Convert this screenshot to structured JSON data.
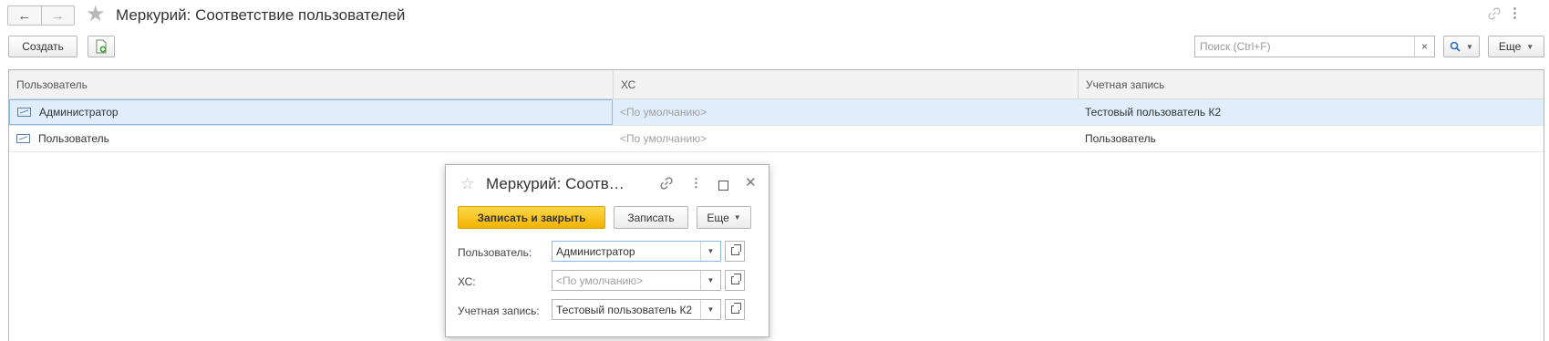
{
  "window": {
    "title": "Меркурий: Соответствие пользователей",
    "back_icon": "←",
    "forward_icon": "→",
    "favorite_icon": "★",
    "more_icon": "⋮"
  },
  "toolbar": {
    "create_label": "Создать",
    "search_placeholder": "Поиск (Ctrl+F)",
    "search_clear_icon": "×",
    "more_label": "Еще"
  },
  "table": {
    "columns": [
      "Пользователь",
      "ХС",
      "Учетная запись"
    ],
    "rows": [
      {
        "user": "Администратор",
        "hs": "<По умолчанию>",
        "account": "Тестовый пользователь К2",
        "selected": true
      },
      {
        "user": "Пользователь",
        "hs": "<По умолчанию>",
        "account": "Пользователь",
        "selected": false
      }
    ]
  },
  "dialog": {
    "title": "Меркурий: Соотв…",
    "star_icon": "☆",
    "more_icon": "⋮",
    "close_icon": "✕",
    "save_close_label": "Записать и закрыть",
    "save_label": "Записать",
    "more_label": "Еще",
    "fields": [
      {
        "label": "Пользователь:",
        "value": "Администратор",
        "placeholder": false
      },
      {
        "label": "ХС:",
        "value": "<По умолчанию>",
        "placeholder": true
      },
      {
        "label": "Учетная запись:",
        "value": "Тестовый пользователь К2",
        "placeholder": false
      }
    ]
  },
  "colors": {
    "accent_yellow": "#f2b300",
    "selected_row": "#dfeefa",
    "search_icon": "#2a6fc6"
  }
}
